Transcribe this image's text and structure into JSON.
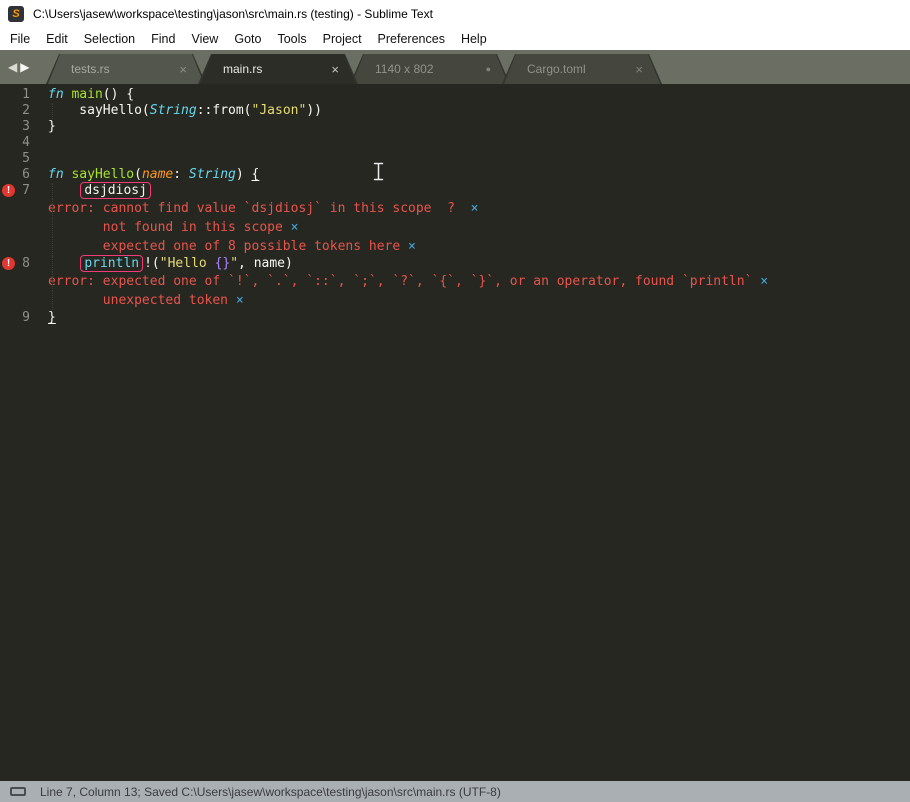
{
  "window": {
    "title": "C:\\Users\\jasew\\workspace\\testing\\jason\\src\\main.rs (testing) - Sublime Text"
  },
  "icons": {
    "logo": "S",
    "back": "◀",
    "forward": "▶",
    "close": "×",
    "modified_dot": "●",
    "error_gutter": "!"
  },
  "colors": {
    "logo_orange": "#ff9800",
    "error_red": "#e8544d",
    "dismiss_blue": "#44a8e0",
    "region_pink": "#f23b77",
    "editor_bg": "#262720",
    "tabbar_bg": "#6b6e63",
    "statusbar_bg": "#aaafb4"
  },
  "menu": {
    "items": [
      "File",
      "Edit",
      "Selection",
      "Find",
      "View",
      "Goto",
      "Tools",
      "Project",
      "Preferences",
      "Help"
    ]
  },
  "tabs": [
    {
      "label": "tests.rs",
      "variant": "v-light",
      "active": false,
      "modified": false
    },
    {
      "label": "main.rs",
      "variant": "v-active",
      "active": true,
      "modified": false
    },
    {
      "label": "1140 x 802",
      "variant": "v-dark",
      "active": false,
      "modified": true
    },
    {
      "label": "Cargo.toml",
      "variant": "v-dark",
      "active": false,
      "modified": false
    }
  ],
  "editor": {
    "rows": [
      {
        "type": "code",
        "num": "1",
        "segs": [
          {
            "t": "fn ",
            "s": "kw"
          },
          {
            "t": "main",
            "s": "fn"
          },
          {
            "t": "() {",
            "s": "pl"
          }
        ]
      },
      {
        "type": "code",
        "num": "2",
        "guide": true,
        "segs": [
          {
            "t": "    sayHello(",
            "s": "pl"
          },
          {
            "t": "String",
            "s": "ty"
          },
          {
            "t": "::from(",
            "s": "pl"
          },
          {
            "t": "\"Jason\"",
            "s": "st"
          },
          {
            "t": "))",
            "s": "pl"
          }
        ]
      },
      {
        "type": "code",
        "num": "3",
        "segs": [
          {
            "t": "}",
            "s": "pl"
          }
        ]
      },
      {
        "type": "code",
        "num": "4",
        "segs": []
      },
      {
        "type": "code",
        "num": "5",
        "segs": []
      },
      {
        "type": "code",
        "num": "6",
        "segs": [
          {
            "t": "fn ",
            "s": "kw"
          },
          {
            "t": "sayHello",
            "s": "fn"
          },
          {
            "t": "(",
            "s": "pl"
          },
          {
            "t": "name",
            "s": "pa"
          },
          {
            "t": ": ",
            "s": "pl"
          },
          {
            "t": "String",
            "s": "ty"
          },
          {
            "t": ") ",
            "s": "pl"
          },
          {
            "t": "{",
            "s": "pl u"
          }
        ]
      },
      {
        "type": "code",
        "num": "7",
        "icon": true,
        "guide": true,
        "segs": [
          {
            "t": "    ",
            "s": "pl"
          },
          {
            "t": "dsjdiosj",
            "s": "pl box"
          }
        ]
      },
      {
        "type": "ann",
        "guide": true,
        "segs": [
          {
            "t": "error: cannot find value `dsjdiosj` in this scope  ?  ",
            "s": "er"
          },
          {
            "t": "×",
            "s": "xb"
          }
        ]
      },
      {
        "type": "ann",
        "guide": true,
        "segs": [
          {
            "t": "       not found in this scope ",
            "s": "er"
          },
          {
            "t": "×",
            "s": "xb"
          }
        ]
      },
      {
        "type": "ann",
        "guide": true,
        "segs": [
          {
            "t": "       expected one of 8 possible tokens here ",
            "s": "er"
          },
          {
            "t": "×",
            "s": "xb"
          }
        ]
      },
      {
        "type": "code",
        "num": "8",
        "icon": true,
        "guide": true,
        "segs": [
          {
            "t": "    ",
            "s": "pl"
          },
          {
            "t": "println",
            "s": "ma box"
          },
          {
            "t": "!(",
            "s": "pl"
          },
          {
            "t": "\"Hello ",
            "s": "st"
          },
          {
            "t": "{}",
            "s": "ph"
          },
          {
            "t": "\"",
            "s": "st"
          },
          {
            "t": ", name)",
            "s": "pl"
          }
        ]
      },
      {
        "type": "ann",
        "guide": true,
        "segs": [
          {
            "t": "error: expected one of `!`, `.`, `::`, `;`, `?`, `{`, `}`, or an operator, found `println` ",
            "s": "er"
          },
          {
            "t": "×",
            "s": "xb"
          }
        ]
      },
      {
        "type": "ann",
        "guide": true,
        "segs": [
          {
            "t": "       unexpected token ",
            "s": "er"
          },
          {
            "t": "×",
            "s": "xb"
          }
        ]
      },
      {
        "type": "code",
        "num": "9",
        "segs": [
          {
            "t": "}",
            "s": "pl u"
          }
        ]
      }
    ]
  },
  "status": {
    "text": "Line 7, Column 13; Saved C:\\Users\\jasew\\workspace\\testing\\jason\\src\\main.rs (UTF-8)"
  }
}
